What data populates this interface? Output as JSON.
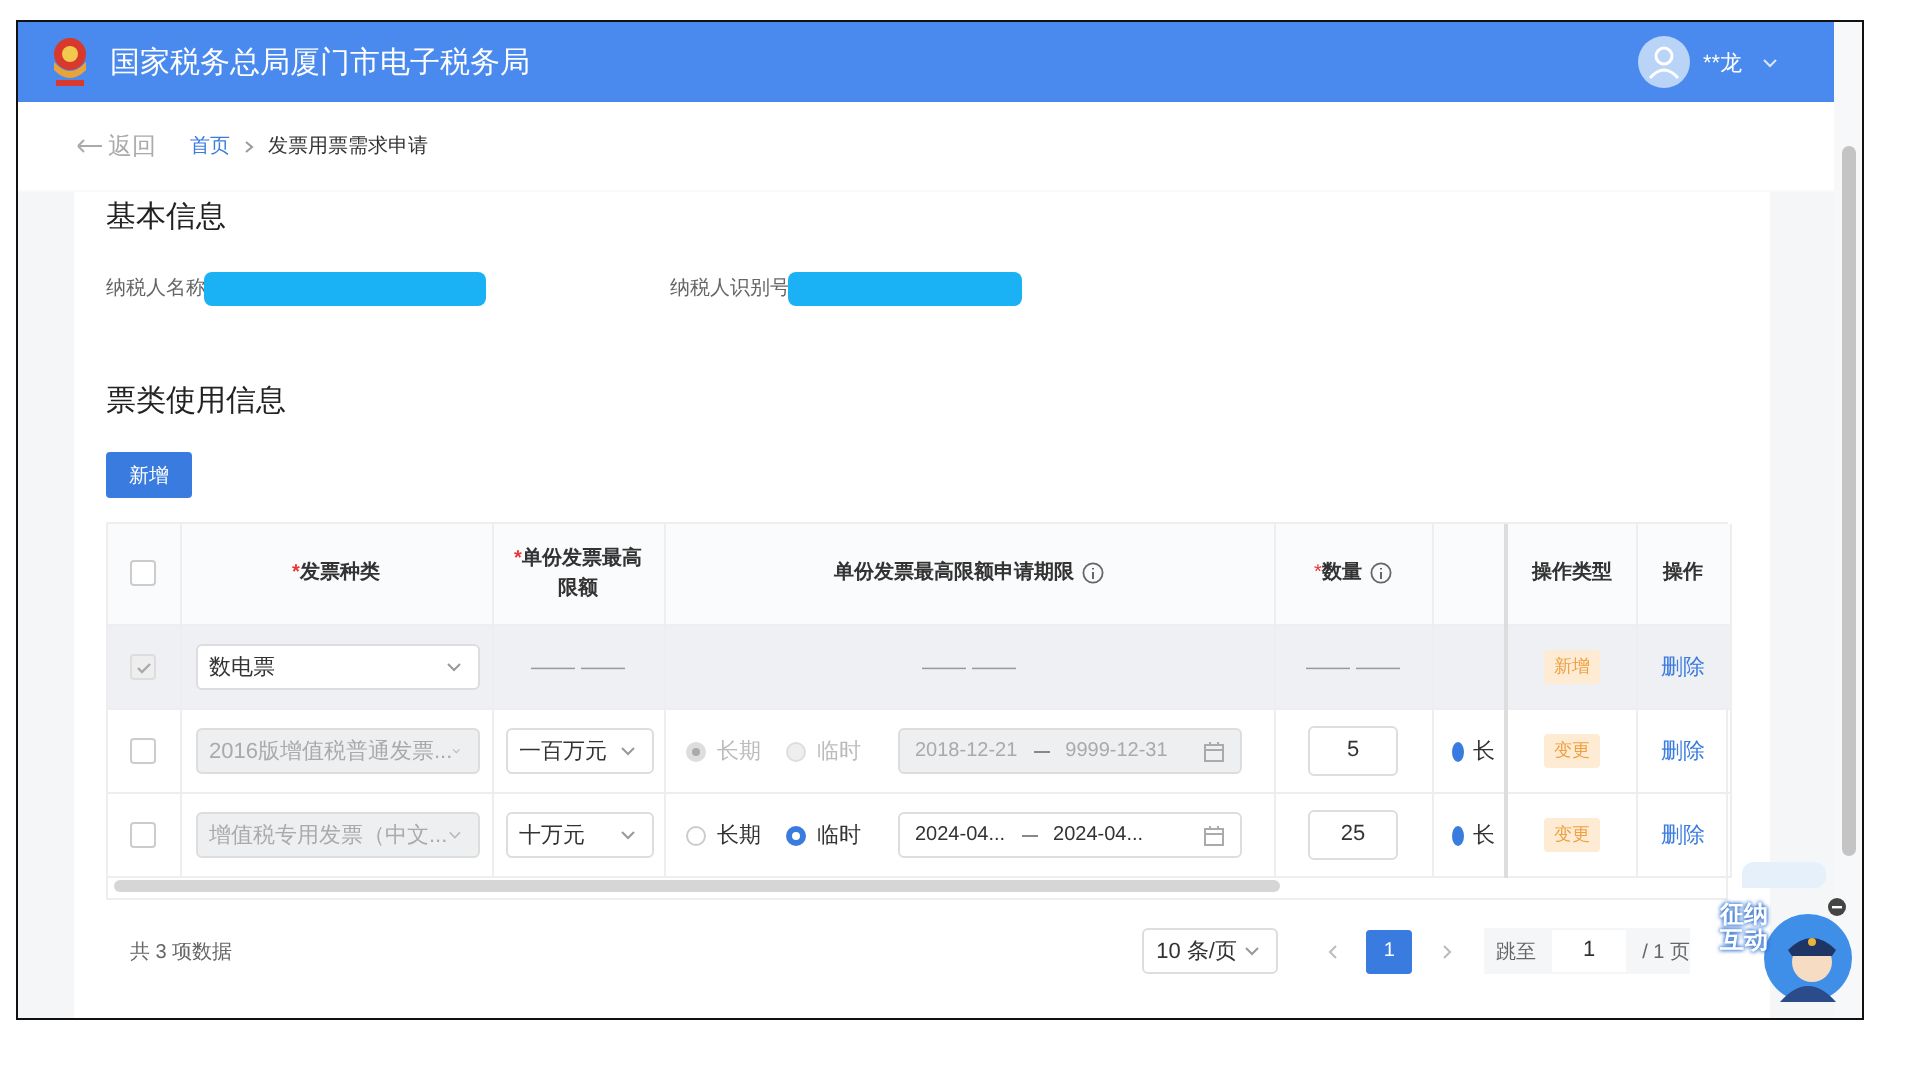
{
  "header": {
    "title": "国家税务总局厦门市电子税务局",
    "user": "**龙"
  },
  "breadcrumb": {
    "back": "返回",
    "items": [
      {
        "label": "首页",
        "link": true
      },
      {
        "label": "发票用票需求申请",
        "link": false
      }
    ]
  },
  "basic_info": {
    "title": "基本信息",
    "fields": [
      {
        "label": "纳税人名称",
        "redacted": true
      },
      {
        "label": "纳税人识别号",
        "redacted": true
      }
    ]
  },
  "usage_info": {
    "title": "票类使用信息",
    "add_button": "新增"
  },
  "table": {
    "select_all": {
      "checked": false
    },
    "columns": [
      {
        "kind": "plain",
        "required_mark": "*",
        "label": "发票种类"
      },
      {
        "kind": "plain",
        "required_mark": "*",
        "label": "单份发票最高限额"
      },
      {
        "kind": "info",
        "label": "单份发票最高限额申请期限"
      },
      {
        "kind": "info",
        "required_mark": "*",
        "label": "数量"
      },
      {
        "kind": "blank"
      },
      {
        "kind": "plain",
        "label": "操作类型"
      },
      {
        "kind": "plain",
        "label": "操作"
      }
    ],
    "rows": [
      {
        "highlighted": true,
        "checkbox": {
          "checked": true,
          "disabled": true
        },
        "invoice_type": {
          "value": "数电票",
          "disabled": false
        },
        "limit": {
          "kind": "dash",
          "text": "—— ——"
        },
        "period": {
          "kind": "dash",
          "text": "—— ——"
        },
        "quantity": {
          "kind": "dash",
          "text": "—— ——"
        },
        "column_5": {
          "kind": "empty"
        },
        "operation_type": "新增",
        "action": "删除"
      },
      {
        "highlighted": false,
        "checkbox": {
          "checked": false,
          "disabled": false
        },
        "invoice_type": {
          "value": "2016版增值税普通发票...",
          "disabled": true
        },
        "limit": {
          "kind": "select",
          "value": "一百万元"
        },
        "period": {
          "kind": "range",
          "disabled": true,
          "options": [
            {
              "label": "长期",
              "selected": true
            },
            {
              "label": "临时",
              "selected": false
            }
          ],
          "start": "2018-12-21",
          "end": "9999-12-31"
        },
        "quantity": {
          "kind": "input",
          "value": "5"
        },
        "column_5": {
          "kind": "radio",
          "label": "长",
          "selected": true
        },
        "operation_type": "变更",
        "action": "删除"
      },
      {
        "highlighted": false,
        "checkbox": {
          "checked": false,
          "disabled": false
        },
        "invoice_type": {
          "value": "增值税专用发票（中文...",
          "disabled": true
        },
        "limit": {
          "kind": "select",
          "value": "十万元"
        },
        "period": {
          "kind": "range",
          "disabled": false,
          "options": [
            {
              "label": "长期",
              "selected": false
            },
            {
              "label": "临时",
              "selected": true
            }
          ],
          "start": "2024-04...",
          "end": "2024-04..."
        },
        "quantity": {
          "kind": "input",
          "value": "25"
        },
        "column_5": {
          "kind": "radio",
          "label": "长",
          "selected": true
        },
        "operation_type": "变更",
        "action": "删除"
      }
    ]
  },
  "pagination": {
    "total": "共 3 项数据",
    "page_size": "10 条/页",
    "pages": [
      {
        "label": "1",
        "selected": true
      }
    ],
    "jump_label": "跳至",
    "jump_value": "1",
    "page_count": "/ 1 页"
  },
  "assistant": {
    "label": "征纳互动"
  }
}
